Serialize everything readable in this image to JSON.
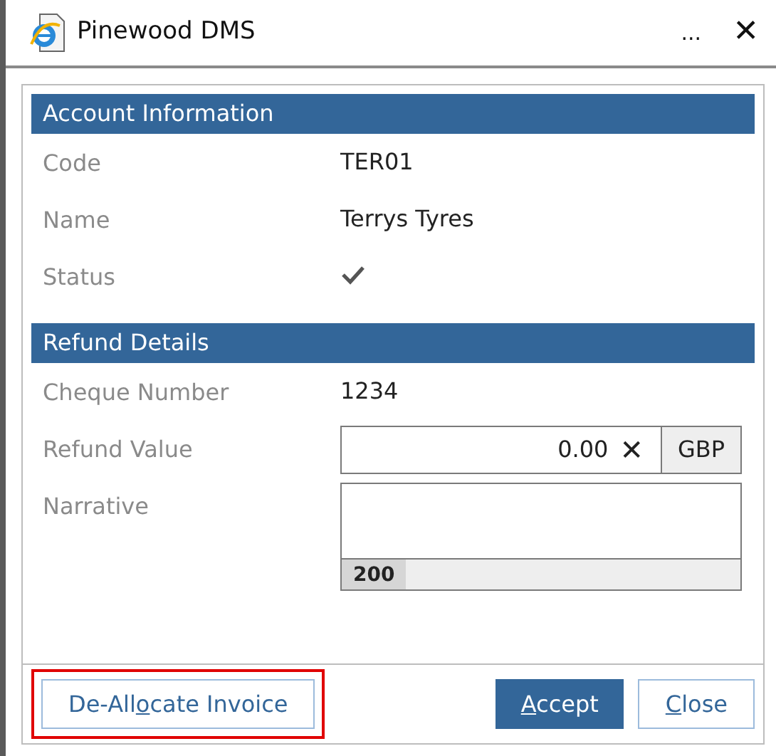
{
  "window": {
    "title": "Pinewood DMS",
    "more": "...",
    "close": "✕"
  },
  "sections": [
    {
      "title": "Account Information",
      "rows": [
        {
          "kind": "text",
          "label": "Code",
          "value": "TER01"
        },
        {
          "kind": "text",
          "label": "Name",
          "value": "Terrys Tyres"
        },
        {
          "kind": "check",
          "label": "Status",
          "checked": true
        }
      ]
    },
    {
      "title": "Refund Details",
      "rows": [
        {
          "kind": "text",
          "label": "Cheque Number",
          "value": "1234"
        },
        {
          "kind": "money",
          "label": "Refund Value",
          "value": "0.00",
          "clear": "✕",
          "currency": "GBP"
        },
        {
          "kind": "memo",
          "label": "Narrative",
          "counter": "200"
        }
      ]
    }
  ],
  "buttons": [
    {
      "before": "De-All",
      "key": "o",
      "after": "cate Invoice",
      "primary": false,
      "highlighted": true
    },
    {
      "key": "A",
      "after": "ccept",
      "primary": true,
      "highlighted": false
    },
    {
      "key": "C",
      "after": "lose",
      "primary": false,
      "highlighted": false
    }
  ]
}
